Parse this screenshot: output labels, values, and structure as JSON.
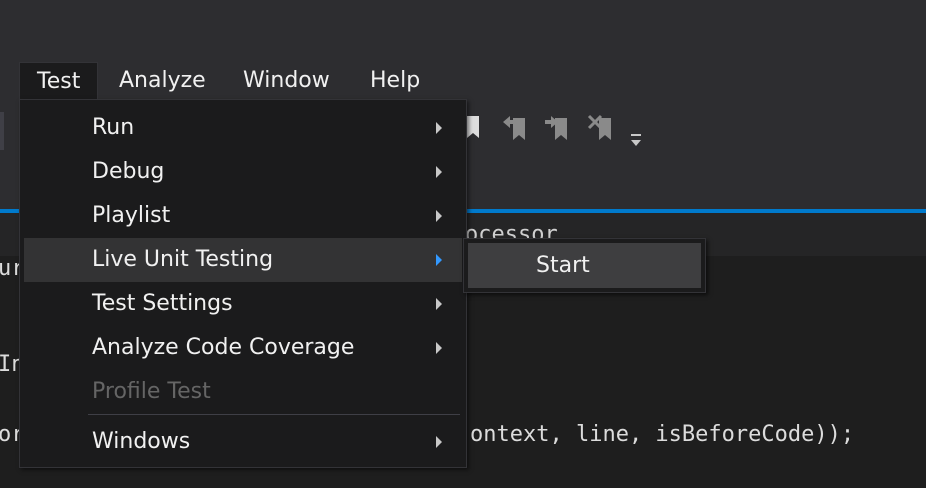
{
  "menubar": {
    "items": [
      {
        "label": "Test"
      },
      {
        "label": "Analyze"
      },
      {
        "label": "Window"
      },
      {
        "label": "Help"
      }
    ]
  },
  "tab": {
    "partial_text": "ocessor"
  },
  "code": {
    "line1": "ur",
    "line2": "In",
    "line3": "or",
    "line3_tail": "ontext, line, isBeforeCode));"
  },
  "test_menu": {
    "items": [
      {
        "label": "Run",
        "submenu": true
      },
      {
        "label": "Debug",
        "submenu": true
      },
      {
        "label": "Playlist",
        "submenu": true
      },
      {
        "label": "Live Unit Testing",
        "submenu": true,
        "highlighted": true
      },
      {
        "label": "Test Settings",
        "submenu": true
      },
      {
        "label": "Analyze Code Coverage",
        "submenu": true
      },
      {
        "label": "Profile Test",
        "disabled": true
      },
      {
        "label": "Windows",
        "submenu": true
      }
    ]
  },
  "live_unit_testing_submenu": {
    "items": [
      {
        "label": "Start"
      }
    ]
  },
  "icons": [
    "bookmark-icon",
    "previous-bookmark-icon",
    "next-bookmark-icon",
    "clear-bookmarks-icon",
    "toolbar-overflow-icon"
  ],
  "colors": {
    "accent": "#007acc",
    "highlight_arrow": "#3399ff"
  }
}
